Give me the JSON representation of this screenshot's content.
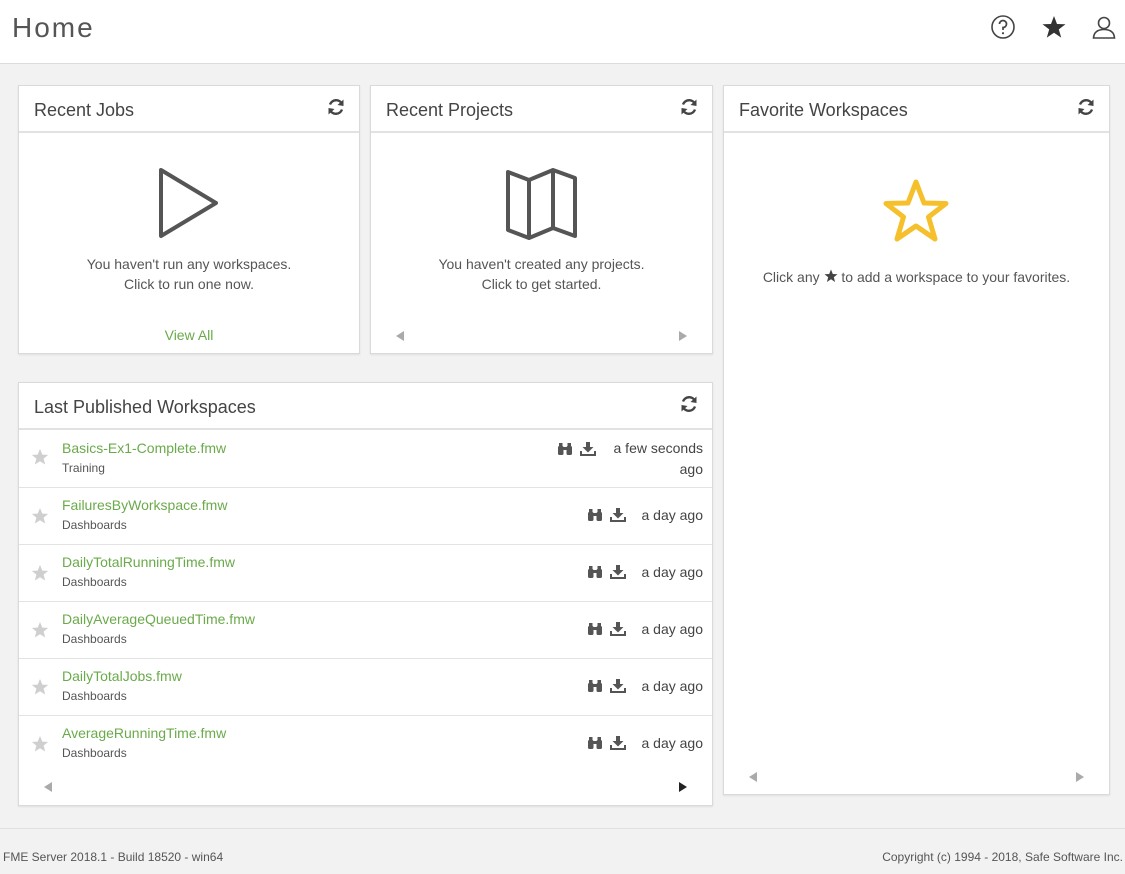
{
  "header": {
    "title": "Home",
    "icons": [
      "help-icon",
      "favorites-star-icon",
      "user-icon"
    ]
  },
  "recent_jobs": {
    "title": "Recent Jobs",
    "message_line1": "You haven't run any workspaces.",
    "message_line2": "Click to run one now.",
    "view_all": "View All"
  },
  "recent_projects": {
    "title": "Recent Projects",
    "message_line1": "You haven't created any projects.",
    "message_line2": "Click to get started."
  },
  "favorite_workspaces": {
    "title": "Favorite Workspaces",
    "message_before": "Click any",
    "message_after": "to add a workspace to your favorites."
  },
  "last_published": {
    "title": "Last Published Workspaces",
    "rows": [
      {
        "name": "Basics-Ex1-Complete.fmw",
        "repository": "Training",
        "time_line1": "a few seconds",
        "time_line2": "ago"
      },
      {
        "name": "FailuresByWorkspace.fmw",
        "repository": "Dashboards",
        "time_line1": "a day ago",
        "time_line2": ""
      },
      {
        "name": "DailyTotalRunningTime.fmw",
        "repository": "Dashboards",
        "time_line1": "a day ago",
        "time_line2": ""
      },
      {
        "name": "DailyAverageQueuedTime.fmw",
        "repository": "Dashboards",
        "time_line1": "a day ago",
        "time_line2": ""
      },
      {
        "name": "DailyTotalJobs.fmw",
        "repository": "Dashboards",
        "time_line1": "a day ago",
        "time_line2": ""
      },
      {
        "name": "AverageRunningTime.fmw",
        "repository": "Dashboards",
        "time_line1": "a day ago",
        "time_line2": ""
      }
    ]
  },
  "footer": {
    "version": "FME Server 2018.1 - Build 18520 - win64",
    "copyright": "Copyright (c) 1994 - 2018, Safe Software Inc."
  },
  "colors": {
    "accent_green": "#6aaa4a",
    "favorite_star": "#f5c02b",
    "icon_grey": "#555555"
  }
}
